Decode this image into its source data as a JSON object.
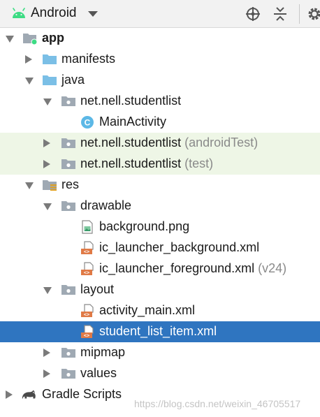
{
  "toolbar": {
    "view_name": "Android",
    "icons": [
      "android-icon",
      "chevron-down-icon",
      "crosshair-target-icon",
      "collapse-all-icon",
      "gear-icon"
    ]
  },
  "colors": {
    "selection": "#2f75c0",
    "test_row_background": "#eef6e6",
    "folder": "#7bbfe6",
    "package_folder": "#9fa9b3",
    "android_green": "#3ddc84",
    "class_icon": "#5cb8e6",
    "xml_icon": "#e07a46"
  },
  "tree": [
    {
      "label": "app",
      "suffix": "",
      "icon": "module-folder-icon",
      "expanded": true
    },
    {
      "label": "manifests",
      "suffix": "",
      "icon": "folder-icon",
      "expanded": false
    },
    {
      "label": "java",
      "suffix": "",
      "icon": "folder-icon",
      "expanded": true
    },
    {
      "label": "net.nell.studentlist",
      "suffix": "",
      "icon": "package-icon",
      "expanded": true
    },
    {
      "label": "MainActivity",
      "suffix": "",
      "icon": "class-icon"
    },
    {
      "label": "net.nell.studentlist",
      "suffix": " (androidTest)",
      "icon": "package-icon",
      "expanded": false
    },
    {
      "label": "net.nell.studentlist",
      "suffix": " (test)",
      "icon": "package-icon",
      "expanded": false
    },
    {
      "label": "res",
      "suffix": "",
      "icon": "resource-folder-icon",
      "expanded": true
    },
    {
      "label": "drawable",
      "suffix": "",
      "icon": "package-icon",
      "expanded": true
    },
    {
      "label": "background.png",
      "suffix": "",
      "icon": "image-file-icon"
    },
    {
      "label": "ic_launcher_background.xml",
      "suffix": "",
      "icon": "xml-file-icon"
    },
    {
      "label": "ic_launcher_foreground.xml",
      "suffix": " (v24)",
      "icon": "xml-file-icon"
    },
    {
      "label": "layout",
      "suffix": "",
      "icon": "package-icon",
      "expanded": true
    },
    {
      "label": "activity_main.xml",
      "suffix": "",
      "icon": "xml-file-icon"
    },
    {
      "label": "student_list_item.xml",
      "suffix": "",
      "icon": "xml-file-icon",
      "selected": true
    },
    {
      "label": "mipmap",
      "suffix": "",
      "icon": "package-icon",
      "expanded": false
    },
    {
      "label": "values",
      "suffix": "",
      "icon": "package-icon",
      "expanded": false
    },
    {
      "label": "Gradle Scripts",
      "suffix": "",
      "icon": "gradle-icon",
      "expanded": false
    }
  ],
  "watermark": "https://blog.csdn.net/weixin_46705517"
}
